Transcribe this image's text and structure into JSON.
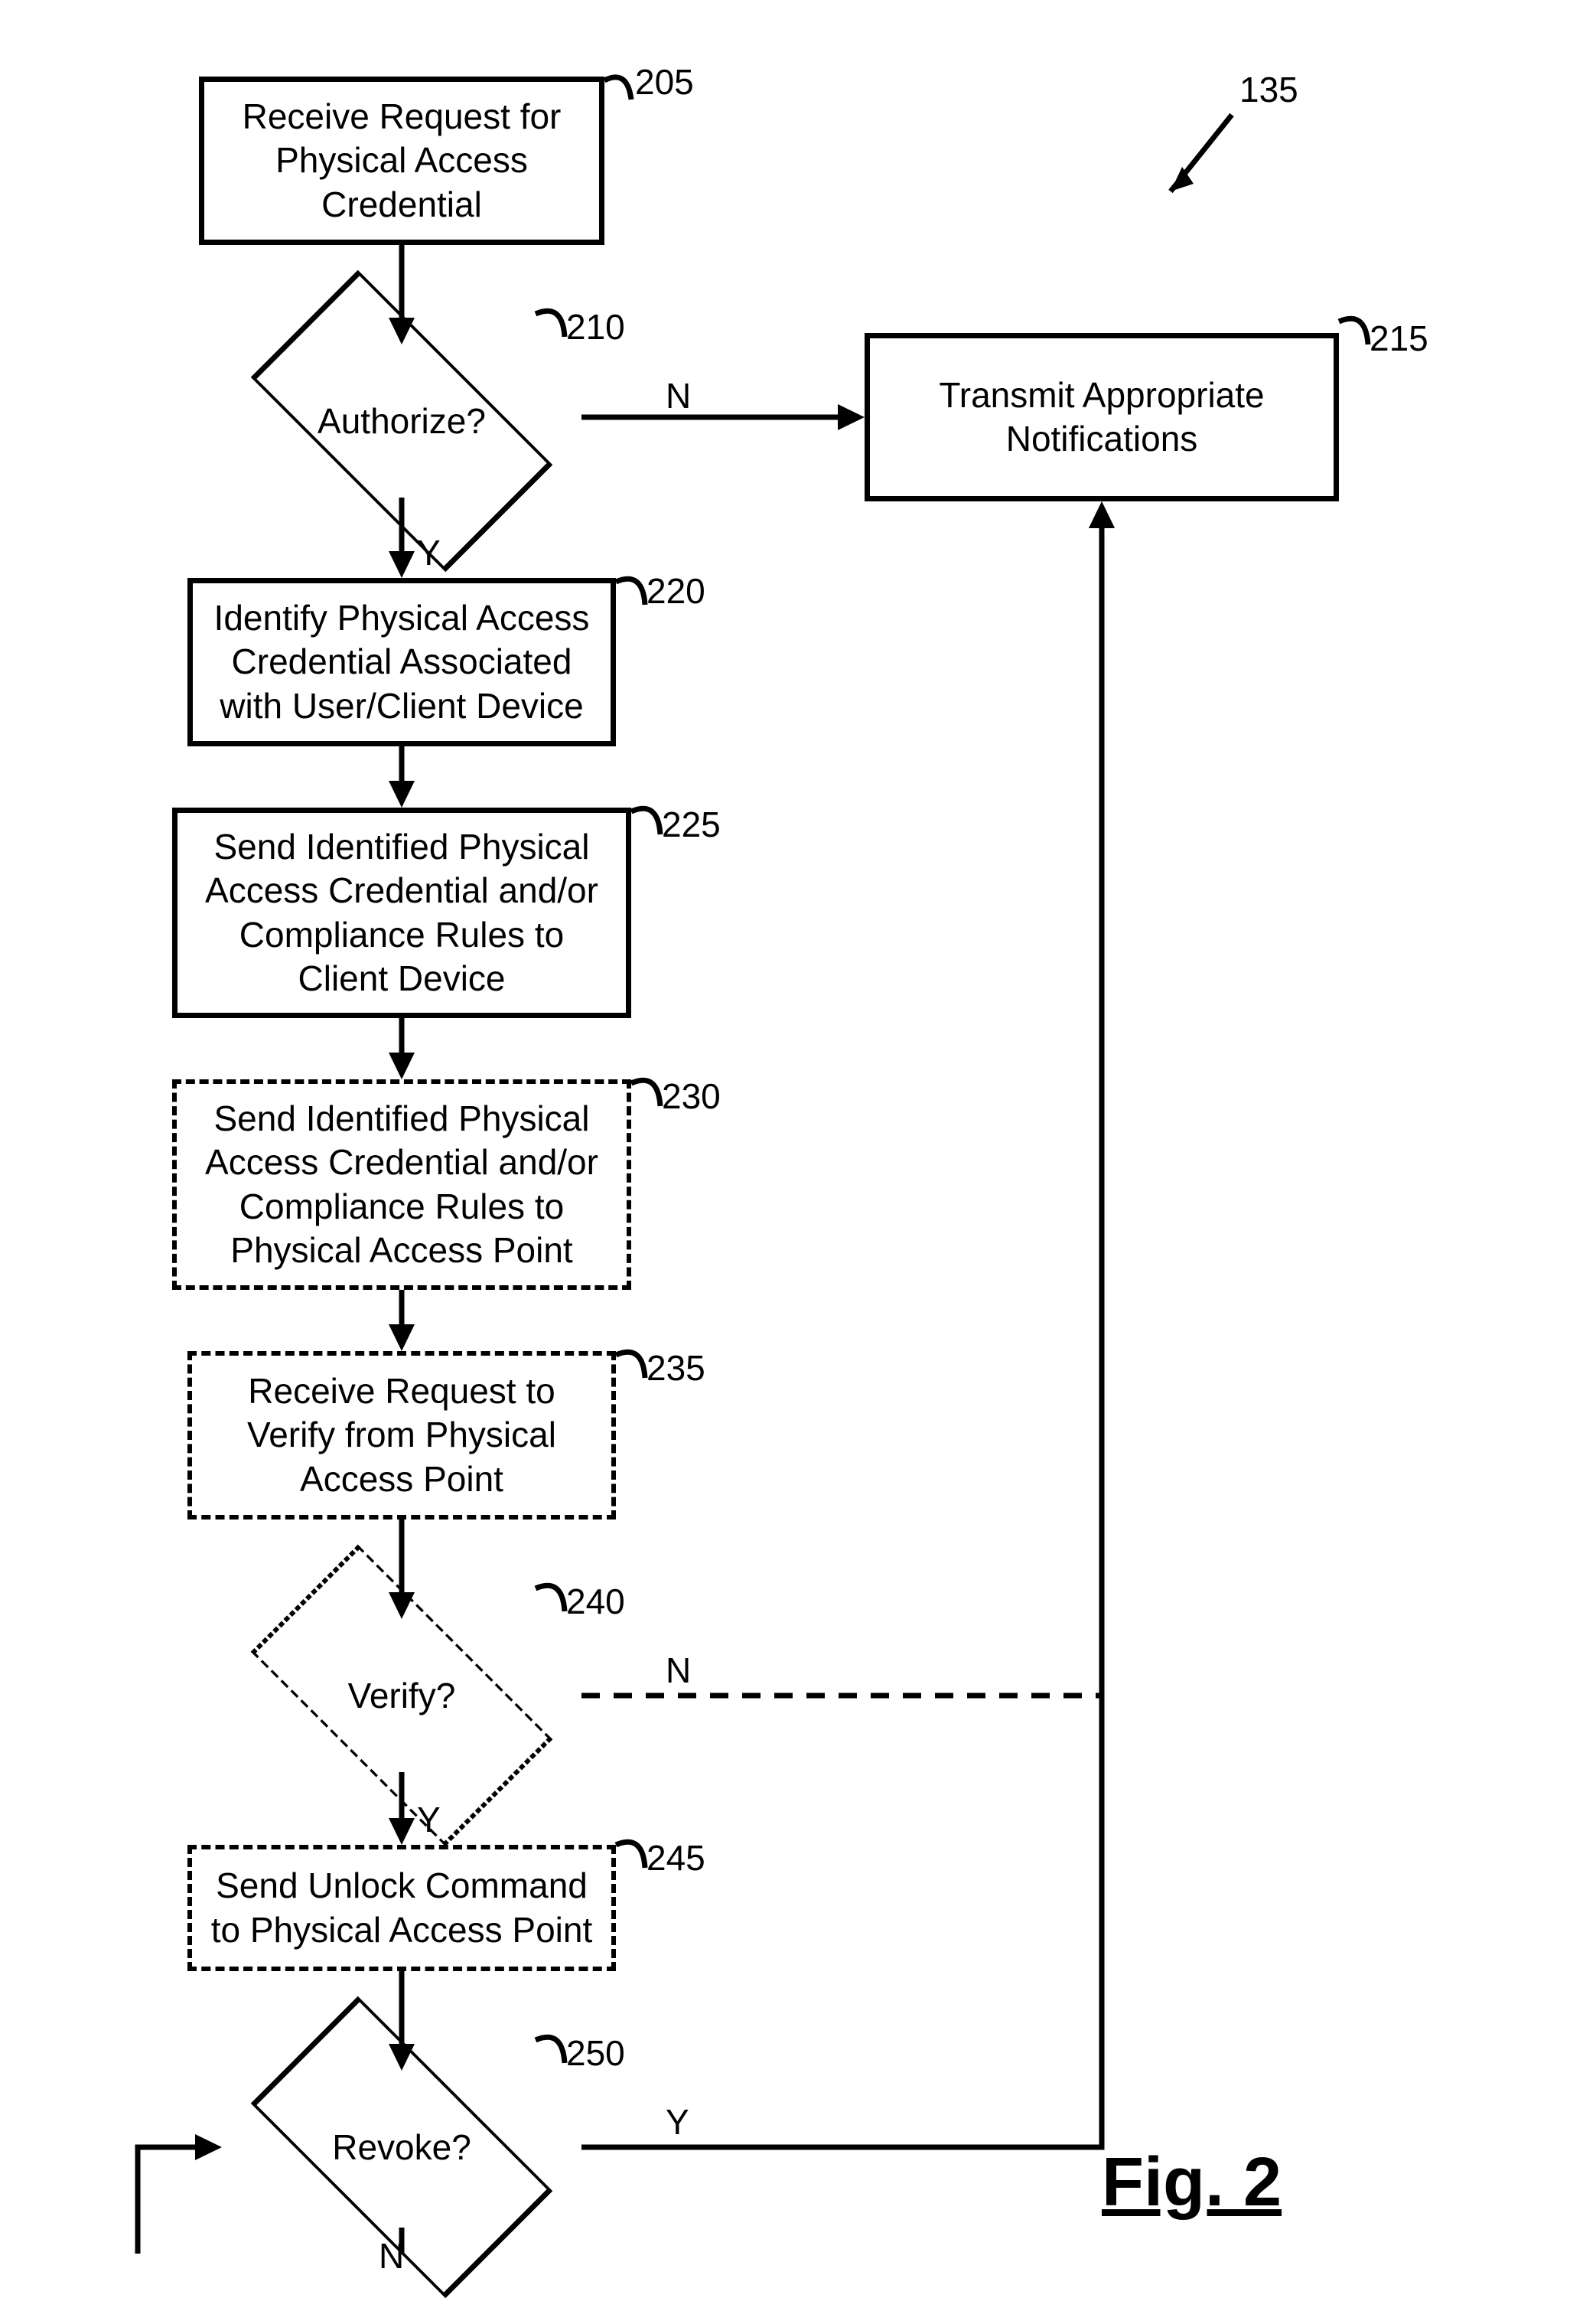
{
  "figure_label": "Fig. 2",
  "figure_ref": "135",
  "nodes": {
    "n205": {
      "ref": "205",
      "text": "Receive Request for Physical Access Credential"
    },
    "n210": {
      "ref": "210",
      "text": "Authorize?"
    },
    "n215": {
      "ref": "215",
      "text": "Transmit Appropriate Notifications"
    },
    "n220": {
      "ref": "220",
      "text": "Identify Physical Access Credential Associated with User/Client Device"
    },
    "n225": {
      "ref": "225",
      "text": "Send Identified Physical Access Credential and/or Compliance Rules to Client Device"
    },
    "n230": {
      "ref": "230",
      "text": "Send Identified Physical Access Credential and/or Compliance Rules to Physical Access Point"
    },
    "n235": {
      "ref": "235",
      "text": "Receive Request to Verify from Physical Access Point"
    },
    "n240": {
      "ref": "240",
      "text": "Verify?"
    },
    "n245": {
      "ref": "245",
      "text": "Send Unlock Command to Physical Access Point"
    },
    "n250": {
      "ref": "250",
      "text": "Revoke?"
    }
  },
  "edge_labels": {
    "n210_y": "Y",
    "n210_n": "N",
    "n240_y": "Y",
    "n240_n": "N",
    "n250_y": "Y",
    "n250_n": "N"
  }
}
